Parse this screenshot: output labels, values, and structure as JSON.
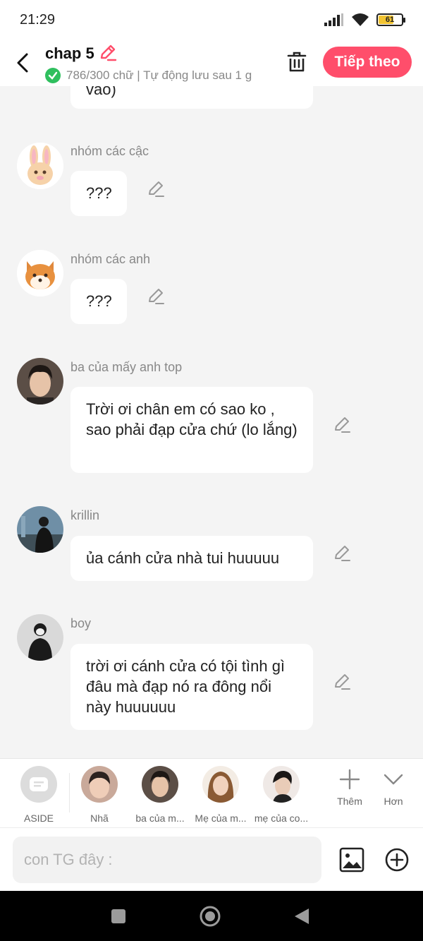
{
  "status": {
    "time": "21:29",
    "battery": "61",
    "battery_level": 0.61
  },
  "header": {
    "title": "chap 5",
    "subtitle": "786/300 chữ | Tự động lưu sau 1 g",
    "next_label": "Tiếp theo"
  },
  "messages": [
    {
      "name": "",
      "text": "vào)"
    },
    {
      "name": "nhóm các cậc",
      "text": "???"
    },
    {
      "name": "nhóm các anh",
      "text": "???"
    },
    {
      "name": "ba của mấy anh top",
      "text": "Trời ơi chân em có sao ko , sao phải đạp cửa chứ (lo lắng)"
    },
    {
      "name": "krillin",
      "text": "ủa cánh cửa nhà tui huuuuu"
    },
    {
      "name": "boy",
      "text": "trời ơi cánh cửa có tội tình gì đâu mà đạp nó ra đông nổi này huuuuuu"
    }
  ],
  "characters": {
    "aside": "ASIDE",
    "items": [
      "Nhã",
      "ba của m...",
      "Mẹ của m...",
      "mẹ của co..."
    ],
    "more_label": "Thêm",
    "expand_label": "Hơn"
  },
  "composer": {
    "placeholder": "con TG đây :"
  },
  "colors": {
    "accent": "#ff4e6b",
    "check": "#2fbf5e",
    "background": "#f4f4f4"
  }
}
